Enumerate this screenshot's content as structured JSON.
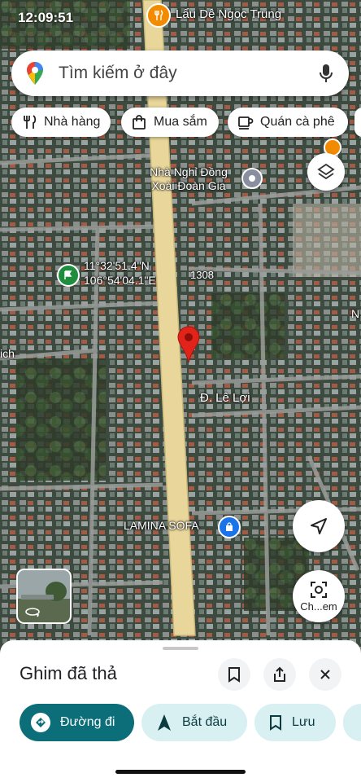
{
  "status_bar": {
    "time": "12:09:51"
  },
  "search": {
    "placeholder": "Tìm kiếm ở đây"
  },
  "chips": [
    {
      "label": "Nhà hàng",
      "icon": "fork-knife-icon"
    },
    {
      "label": "Mua sắm",
      "icon": "shopping-bag-icon"
    },
    {
      "label": "Quán cà phê",
      "icon": "coffee-cup-icon"
    }
  ],
  "map": {
    "poi_top": "Lẩu Dê Ngọc Trung",
    "poi_hotel": "Nhà Nghỉ Đồng Xoài Đoàn Gia",
    "coordinates": {
      "lat": "11°32'51.4\"N",
      "lon": "106°54'04.1\"E"
    },
    "road_number": "1308",
    "road_name": "Đ. Lê Lợi",
    "poi_store": "LAMINA SOFA",
    "edge_label_left": "ich",
    "edge_label_right": "N",
    "colors": {
      "main_road": "#e8d69a",
      "pin": "#e2231a",
      "marker_green": "#1e8e3e",
      "store_marker": "#1a73e8"
    }
  },
  "controls": {
    "explore_label": "Ch...em"
  },
  "sheet": {
    "title": "Ghim đã thả",
    "actions": [
      {
        "label": "Đường đi",
        "icon": "directions-icon",
        "primary": true
      },
      {
        "label": "Bắt đầu",
        "icon": "navigation-arrow-icon",
        "primary": false
      },
      {
        "label": "Lưu",
        "icon": "bookmark-icon",
        "primary": false
      }
    ]
  }
}
